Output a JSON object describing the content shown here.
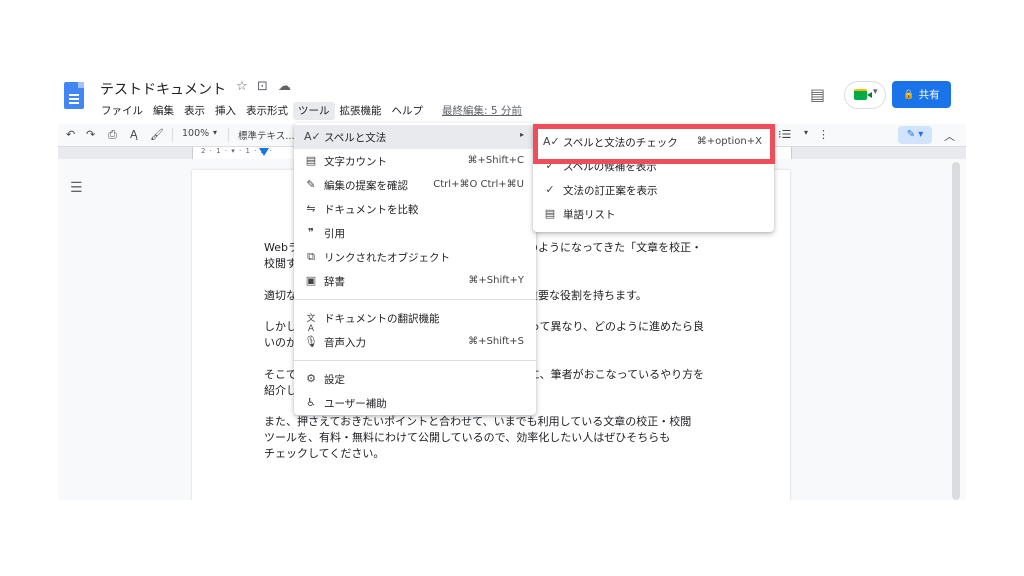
{
  "header": {
    "doc_title": "テストドキュメント",
    "title_icons": [
      "star-icon",
      "folder-move-icon",
      "cloud-status-icon"
    ],
    "menubar": [
      "ファイル",
      "編集",
      "表示",
      "挿入",
      "表示形式",
      "ツール",
      "拡張機能",
      "ヘルプ"
    ],
    "active_menu": "ツール",
    "last_edit": "最終編集: 5 分前",
    "share_label": "共有",
    "lock_glyph": "🔒",
    "comment_glyph": "▤",
    "meet_chevron": "▾"
  },
  "toolbar": {
    "undo": "↶",
    "redo": "↷",
    "print": "⎙",
    "spell": "Ą",
    "paint": "🖌",
    "zoom": "100%",
    "zoom_caret": "▾",
    "style": "標準テキス…",
    "list_glyph": "⁝☰",
    "list_caret": "▾",
    "more_glyph": "⋮",
    "edit_mode": "✎ ▾",
    "collapse": "︿"
  },
  "ruler": {
    "numbers": "2  ·  1  ·  ▾  ·  1  ·  2  ·"
  },
  "outline_glyph": "☰",
  "document": {
    "paragraphs": [
      [
        "Webラ",
        "のようになってきた「文章を校正・",
        "校閲す"
      ],
      [
        "適切な",
        "重要な役割を持ちます。"
      ],
      [
        "しかし",
        "って異なり、どのように進めたら良",
        "いのか"
      ],
      [
        "そこで",
        "に、筆者がおこなっているやり方を",
        "紹介し"
      ],
      [
        "また、押さえておきたいポイントと合わせて、いまでも利用している文章の校正・校閲",
        "ツールを、有料・無料にわけて公開しているので、効率化したい人はぜひそちらも",
        "チェックしてください。"
      ]
    ]
  },
  "tools_menu": {
    "items": [
      {
        "icon": "A✓",
        "icon_name": "spelling-grammar-icon",
        "label": "スペルと文法",
        "shortcut": "",
        "submenu": "▸"
      },
      {
        "icon": "▤",
        "icon_name": "word-count-icon",
        "label": "文字カウント",
        "shortcut": "⌘+Shift+C"
      },
      {
        "icon": "✎",
        "icon_name": "review-suggestions-icon",
        "label": "編集の提案を確認",
        "shortcut": "Ctrl+⌘O Ctrl+⌘U"
      },
      {
        "icon": "⇋",
        "icon_name": "compare-documents-icon",
        "label": "ドキュメントを比較",
        "shortcut": ""
      },
      {
        "icon": "❞",
        "icon_name": "citation-icon",
        "label": "引用",
        "shortcut": ""
      },
      {
        "icon": "⧉",
        "icon_name": "linked-objects-icon",
        "label": "リンクされたオブジェクト",
        "shortcut": ""
      },
      {
        "icon": "▣",
        "icon_name": "dictionary-icon",
        "label": "辞書",
        "shortcut": "⌘+Shift+Y"
      },
      {
        "icon": "文A",
        "icon_name": "translate-icon",
        "label": "ドキュメントの翻訳機能",
        "shortcut": ""
      },
      {
        "icon": "🎙",
        "icon_name": "microphone-icon",
        "label": "音声入力",
        "shortcut": "⌘+Shift+S"
      },
      {
        "icon": "⚙",
        "icon_name": "preferences-icon",
        "label": "設定",
        "shortcut": ""
      },
      {
        "icon": "♿",
        "icon_name": "accessibility-icon",
        "label": "ユーザー補助",
        "shortcut": ""
      }
    ]
  },
  "spelling_menu": {
    "items": [
      {
        "icon": "A✓",
        "icon_name": "spell-check-icon",
        "label": "スペルと文法のチェック",
        "shortcut": "⌘+option+X"
      },
      {
        "icon": "✓",
        "icon_name": "checkmark-icon",
        "label": "スペルの候補を表示",
        "shortcut": ""
      },
      {
        "icon": "✓",
        "icon_name": "checkmark-icon",
        "label": "文法の訂正案を表示",
        "shortcut": ""
      },
      {
        "icon": "▤",
        "icon_name": "dictionary-list-icon",
        "label": "単語リスト",
        "shortcut": ""
      }
    ]
  },
  "colors": {
    "accent": "#1a73e8",
    "highlight": "#ee4e5a",
    "menu_hover": "#e8eaed"
  }
}
